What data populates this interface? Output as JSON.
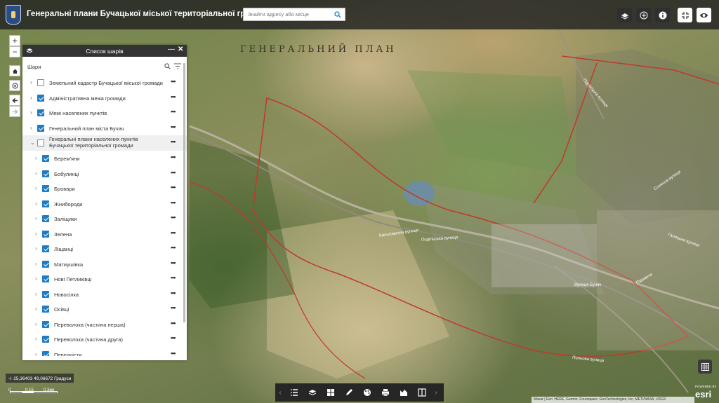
{
  "header": {
    "title": "Генеральні плани Бучацької міської територіальної громади",
    "search_placeholder": "Знайти адресу або місце"
  },
  "map": {
    "labels": [
      "ГЕНЕРАЛЬНИЙ ПЛАН",
      "Ка́льтовична вулиця",
      "Подільська вулиця",
      "Польова вулиця",
      "Вулиця Бучач",
      "Підгаєцька вулиця",
      "Сонячна вулиця",
      "Галицька вулиця",
      "Підзамче"
    ]
  },
  "layer_panel": {
    "title": "Список шарів",
    "layers_label": "Шари",
    "layers": [
      {
        "label": "Земельний кадастр Бучацької міської громади",
        "checked": false,
        "indent": 0
      },
      {
        "label": "Адміністративна межа громади",
        "checked": true,
        "indent": 0
      },
      {
        "label": "Межі населених пунктів",
        "checked": true,
        "indent": 0
      },
      {
        "label": "Генеральний план міста Бучач",
        "checked": true,
        "indent": 0
      },
      {
        "label": "Генеральні плани населених пунктів Бучацької територіальної громади",
        "checked": false,
        "indent": 0,
        "expanded": true
      },
      {
        "label": "Берем'яни",
        "checked": true,
        "indent": 1
      },
      {
        "label": "Бобулинці",
        "checked": true,
        "indent": 1
      },
      {
        "label": "Бровари",
        "checked": true,
        "indent": 1
      },
      {
        "label": "Жнибороди",
        "checked": true,
        "indent": 1
      },
      {
        "label": "Заліщики",
        "checked": true,
        "indent": 1
      },
      {
        "label": "Зелена",
        "checked": true,
        "indent": 1
      },
      {
        "label": "Ліщанці",
        "checked": true,
        "indent": 1
      },
      {
        "label": "Матиушівка",
        "checked": true,
        "indent": 1
      },
      {
        "label": "Нові Петликівці",
        "checked": true,
        "indent": 1
      },
      {
        "label": "Новосілка",
        "checked": true,
        "indent": 1
      },
      {
        "label": "Осівці",
        "checked": true,
        "indent": 1
      },
      {
        "label": "Переволока (частина перша)",
        "checked": true,
        "indent": 1
      },
      {
        "label": "Переволока (частина друга)",
        "checked": true,
        "indent": 1
      },
      {
        "label": "Передністя",
        "checked": true,
        "indent": 1
      }
    ]
  },
  "footer": {
    "coordinates": "25,36403 49,06672 Градуси",
    "scale_labels": [
      "0",
      "0,15",
      "0,3км"
    ],
    "attribution": "Maxar | Esri, HERE, Garmin, Foursquare, GeoTechnologies, Inc, METI/NASA, USGS",
    "esri_powered": "POWERED BY",
    "esri_logo": "esri"
  },
  "colors": {
    "header_bg": "#222222",
    "accent_checkbox": "#1f7bc4",
    "boundary": "#c0392b"
  }
}
